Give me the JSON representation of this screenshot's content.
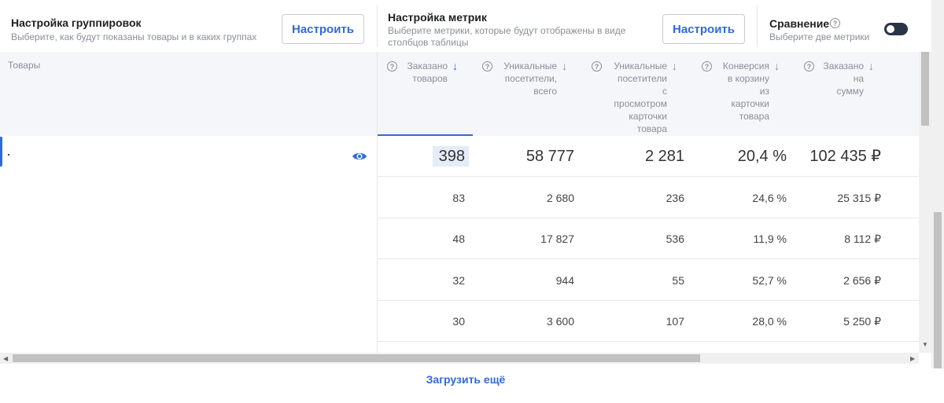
{
  "grouping": {
    "title": "Настройка группировок",
    "subtitle": "Выберите, как будут показаны товары и в каких группах",
    "button": "Настроить"
  },
  "metrics": {
    "title": "Настройка метрик",
    "subtitle_line1": "Выберите метрики, которые будут отображены в виде",
    "subtitle_line2": "столбцов таблицы",
    "button": "Настроить"
  },
  "comparison": {
    "title": "Сравнение",
    "subtitle": "Выберите две метрики",
    "toggle_on": false
  },
  "table": {
    "products_header": "Товары",
    "columns": [
      {
        "lines": [
          "Заказано",
          "товаров"
        ],
        "sorted": true
      },
      {
        "lines": [
          "Уникальные",
          "посетители,",
          "всего"
        ],
        "sorted": false
      },
      {
        "lines": [
          "Уникальные",
          "посетители",
          "с",
          "просмотром",
          "карточки",
          "товара"
        ],
        "sorted": false
      },
      {
        "lines": [
          "Конверсия",
          "в корзину",
          "из",
          "карточки",
          "товара"
        ],
        "sorted": false
      },
      {
        "lines": [
          "Заказано",
          "на",
          "сумму"
        ],
        "sorted": false
      }
    ],
    "total_row": [
      "398",
      "58 777",
      "2 281",
      "20,4 %",
      "102 435 ₽"
    ],
    "rows": [
      [
        "83",
        "2 680",
        "236",
        "24,6 %",
        "25 315 ₽"
      ],
      [
        "48",
        "17 827",
        "536",
        "11,9 %",
        "8 112 ₽"
      ],
      [
        "32",
        "944",
        "55",
        "52,7 %",
        "2 656 ₽"
      ],
      [
        "30",
        "3 600",
        "107",
        "28,0 %",
        "5 250 ₽"
      ]
    ]
  },
  "load_more": "Загрузить ещё",
  "colors": {
    "accent": "#2f6bd8",
    "header_bg": "#f4f6f9"
  }
}
